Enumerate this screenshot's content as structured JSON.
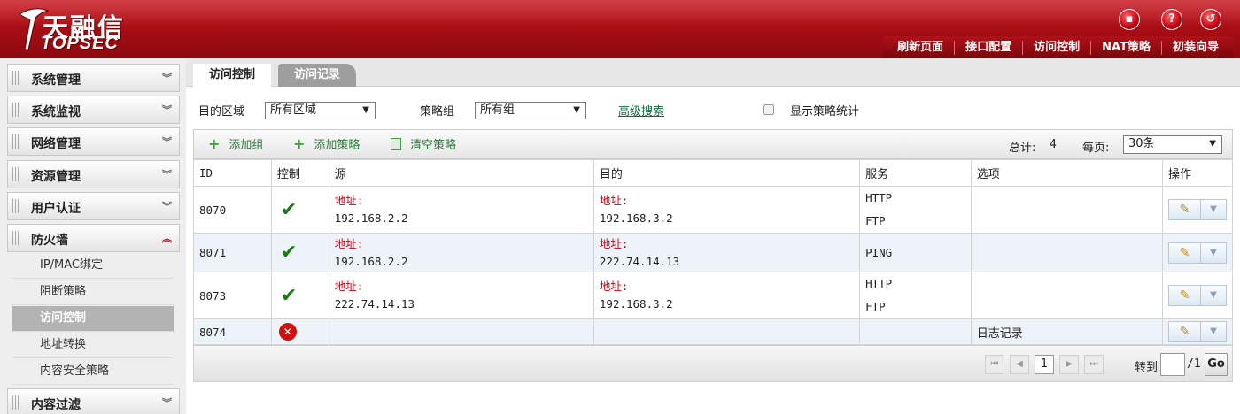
{
  "brand": {
    "name_zh": "天融信",
    "name_en": "TOPSEC"
  },
  "header": {
    "top_icons": [
      "save-icon",
      "help-icon",
      "logout-icon"
    ],
    "nav": [
      "刷新页面",
      "接口配置",
      "访问控制",
      "NAT策略",
      "初装向导"
    ]
  },
  "sidebar": {
    "menus": [
      "系统管理",
      "系统监视",
      "网络管理",
      "资源管理",
      "用户认证",
      "防火墙",
      "内容过滤"
    ],
    "firewall_sub": [
      "IP/MAC绑定",
      "阻断策略",
      "访问控制",
      "地址转换",
      "内容安全策略"
    ],
    "active_sub": "访问控制"
  },
  "tabs": [
    "访问控制",
    "访问记录"
  ],
  "filters": {
    "zone_label": "目的区域",
    "zone_value": "所有区域",
    "group_label": "策略组",
    "group_value": "所有组",
    "advanced_search": "高级搜索",
    "show_stats_label": "显示策略统计"
  },
  "toolbar": {
    "add_group": "添加组",
    "add_policy": "添加策略",
    "clear_policy": "清空策略",
    "total_label": "总计:",
    "total_value": "4",
    "per_page_label": "每页:",
    "per_page_value": "30条"
  },
  "table": {
    "columns": [
      "ID",
      "控制",
      "源",
      "目的",
      "服务",
      "选项",
      "操作"
    ],
    "address_label": "地址:",
    "rows": [
      {
        "id": "8070",
        "control": "allow",
        "src": "192.168.2.2",
        "dst": "192.168.3.2",
        "services": [
          "HTTP",
          "FTP"
        ],
        "options": ""
      },
      {
        "id": "8071",
        "control": "allow",
        "src": "192.168.2.2",
        "dst": "222.74.14.13",
        "services": [
          "PING"
        ],
        "options": ""
      },
      {
        "id": "8073",
        "control": "allow",
        "src": "222.74.14.13",
        "dst": "192.168.3.2",
        "services": [
          "HTTP",
          "FTP"
        ],
        "options": ""
      },
      {
        "id": "8074",
        "control": "deny",
        "src": "",
        "dst": "",
        "services": [],
        "options": "日志记录"
      }
    ]
  },
  "pager": {
    "page": "1",
    "goto_label": "转到",
    "pages": "/1",
    "go": "Go"
  },
  "colors": {
    "header_red": "#b0121a",
    "link_green": "#0f6b38",
    "address_red": "#c40010",
    "allow_green": "#1c7a14"
  }
}
